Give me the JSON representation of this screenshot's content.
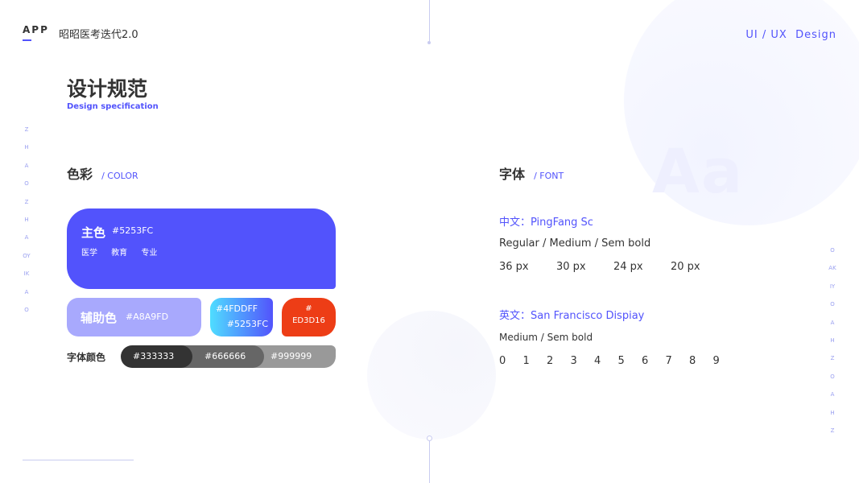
{
  "header": {
    "app_label": "APP",
    "app_title": "昭昭医考迭代2.0",
    "right_label": "UI / UX  Design"
  },
  "side_text": {
    "left": "ZHAOZHAOYIKAO",
    "right": "OAKIYOAHZOAHZ"
  },
  "page": {
    "title_cn": "设计规范",
    "title_en": "Design specification"
  },
  "color_section": {
    "title_cn": "色彩",
    "title_en": "/ COLOR",
    "primary": {
      "name": "主色",
      "hex": "#5253FC",
      "tags": "医学 教育 专业",
      "color": "#5253FC"
    },
    "secondary": {
      "name": "辅助色",
      "hex": "#A8A9FD",
      "color": "#A8A9FD"
    },
    "gradient": {
      "from": "#4FDDFF",
      "to": "#5253FC"
    },
    "accent": {
      "hash": "#",
      "code": "ED3D16",
      "color": "#ED3D16"
    },
    "font_colors_label": "字体颜色",
    "font_colors": [
      "#333333",
      "#666666",
      "#999999"
    ]
  },
  "font_section": {
    "title_cn": "字体",
    "title_en": "/ FONT",
    "watermark": "Aa",
    "cn_font": "中文：PingFang Sc",
    "cn_weights": "Regular / Medium / Sem bold",
    "cn_sizes": [
      "36 px",
      "30 px",
      "24 px",
      "20 px"
    ],
    "en_font": "英文：San Francisco Dispiay",
    "en_weights": "Medium / Sem bold",
    "digits": [
      "0",
      "1",
      "2",
      "3",
      "4",
      "5",
      "6",
      "7",
      "8",
      "9"
    ]
  }
}
